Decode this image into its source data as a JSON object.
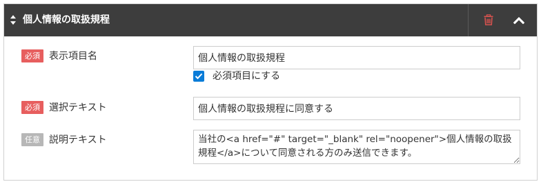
{
  "header": {
    "title": "個人情報の取扱規程"
  },
  "fields": {
    "display_name": {
      "badge": "必須",
      "label": "表示項目名",
      "value": "個人情報の取扱規程"
    },
    "required_checkbox": {
      "label": "必須項目にする",
      "checked": true
    },
    "select_text": {
      "badge": "必須",
      "label": "選択テキスト",
      "value": "個人情報の取扱規程に同意する"
    },
    "description": {
      "badge": "任意",
      "label": "説明テキスト",
      "value": "当社の<a href=\"#\" target=\"_blank\" rel=\"noopener\">個人情報の取扱規程</a>について同意される方のみ送信できます。"
    }
  },
  "colors": {
    "header_bg": "#3d3d3d",
    "required_badge": "#e75e5e",
    "optional_badge": "#b7b7b7",
    "checkbox": "#0a7cd8",
    "trash_icon": "#d9534f"
  },
  "icons": {
    "sort": "sort-arrows-icon",
    "trash": "trash-icon",
    "collapse": "chevron-up-icon",
    "check": "checkmark-icon"
  }
}
